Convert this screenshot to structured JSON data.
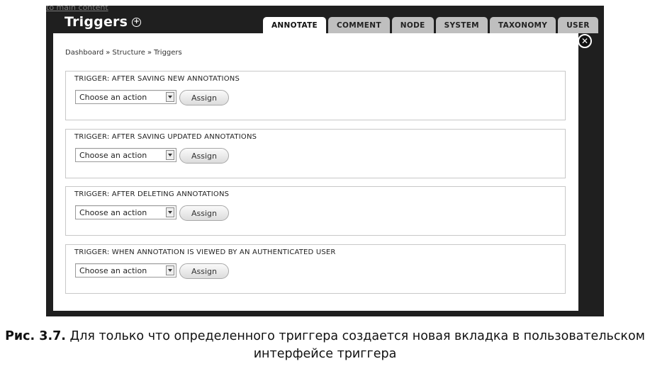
{
  "background": {
    "link_text": "to main content"
  },
  "header": {
    "title": "Triggers",
    "title_icon": "plus-circle-icon",
    "tabs": [
      {
        "label": "ANNOTATE",
        "active": true
      },
      {
        "label": "COMMENT",
        "active": false
      },
      {
        "label": "NODE",
        "active": false
      },
      {
        "label": "SYSTEM",
        "active": false
      },
      {
        "label": "TAXONOMY",
        "active": false
      },
      {
        "label": "USER",
        "active": false
      }
    ],
    "close_icon": "close-icon"
  },
  "breadcrumb": {
    "items": [
      "Dashboard",
      "Structure",
      "Triggers"
    ],
    "separator": "»"
  },
  "triggers": [
    {
      "label": "TRIGGER: AFTER SAVING NEW ANNOTATIONS",
      "select_value": "Choose an action",
      "button_label": "Assign"
    },
    {
      "label": "TRIGGER: AFTER SAVING UPDATED ANNOTATIONS",
      "select_value": "Choose an action",
      "button_label": "Assign"
    },
    {
      "label": "TRIGGER: AFTER DELETING ANNOTATIONS",
      "select_value": "Choose an action",
      "button_label": "Assign"
    },
    {
      "label": "TRIGGER: WHEN ANNOTATION IS VIEWED BY AN AUTHENTICATED USER",
      "select_value": "Choose an action",
      "button_label": "Assign"
    }
  ],
  "caption": {
    "prefix": "Рис. 3.7.",
    "text": "Для только что определенного триггера создается новая вкладка в пользовательском интерфейсе триггера"
  },
  "colors": {
    "overlay": "#1f1f1f",
    "tab_inactive": "#bfbfbf",
    "tab_active": "#ffffff",
    "panel": "#ffffff"
  }
}
